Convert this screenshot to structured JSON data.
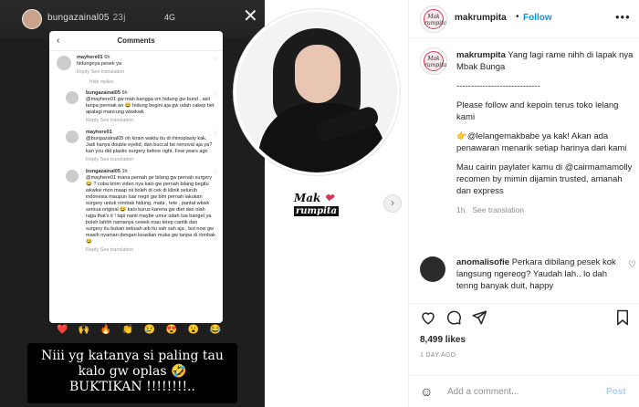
{
  "story": {
    "username": "bungazainal05",
    "time": "23j",
    "status": "4G",
    "phone_title": "Comments",
    "comments": [
      {
        "user": "mayhere01",
        "time": "6h",
        "text": "hidungnya pesek ya",
        "meta": "Reply   See translation"
      },
      {
        "user": "bungazainal05",
        "time": "6h",
        "text": "@mayhere01 gw mah bangga sm hidung gw bund , asli tanpa permak an 😂 hidung begini aja gw udah cakep bet apalagi mancung wkwkwk",
        "meta": "Reply   See translation"
      },
      {
        "user": "mayhere01",
        "time": "",
        "text": "@bungazainal05 oh kirain waktu itu di rhinoplasty kak. Jadi hanya double eyelid, dan buccal fat removal aja ya?kan you did plastic surgery before right. Few years ago",
        "meta": "Reply   See translation"
      },
      {
        "user": "bungazainal05",
        "time": "1h",
        "text": "@mayhere01 mana pernah ge bilang gw pernah surgery 😂 ? coba kirim video nya kalo gw pernah bilang begitu wkwkw mon maap nii boleh di cek di klinik seluruh indonesia maupun luar negri gw blm pernah lakukan surgery untuk rombak hidung, mata , tete , pantat wkwk semua original 😂 kalo kurus karena gw diet dan olah raga that's it ! tapi nanti maybe umur udah tua banget ya boleh lahhh namanya cewek mau tetep cantik dan surgery itu bukan sebuah aib itu sah sah aja , but now gw masih nyaman dengan keaslian muka gw tanpa di rombak 😂",
        "meta": "Reply   See translation"
      }
    ],
    "hide_replies": "Hide replies",
    "emojis": [
      "❤️",
      "🙌",
      "🔥",
      "👏",
      "😢",
      "😍",
      "😮",
      "😂"
    ],
    "caption": [
      "Niii yg katanya si paling tau",
      "kalo gw oplas 🤣",
      "BUKTIKAN !!!!!!!!.."
    ],
    "watermark_top": "Mak",
    "watermark_bottom": "rumpita"
  },
  "header": {
    "username": "makrumpita",
    "dot": "•",
    "follow": "Follow",
    "logo_text": "Mak rumpita"
  },
  "post": {
    "username": "makrumpita",
    "paragraphs": [
      "Yang lagi rame nihh di lapak nya Mbak Bunga",
      "-----------------------------",
      "Please follow and kepoin terus toko lelang kami",
      "👉@lelangemakbabe ya kak! Akan ada penawaran menarik setiap harinya dari kami",
      "Mau cairin paylater kamu di @cairmamamolly recomen by mimin dijamin trusted, amanah dan express"
    ],
    "time": "1h",
    "see_translation": "See translation"
  },
  "comment": {
    "username": "anomalisofie",
    "text": "Perkara dibilang pesek kok langsung ngereog? Yaudah lah.. lo dah tenng banyak duit, happy"
  },
  "likes": "8,499 likes",
  "ago": "1 DAY AGO",
  "add_comment": {
    "placeholder": "Add a comment...",
    "post": "Post"
  }
}
